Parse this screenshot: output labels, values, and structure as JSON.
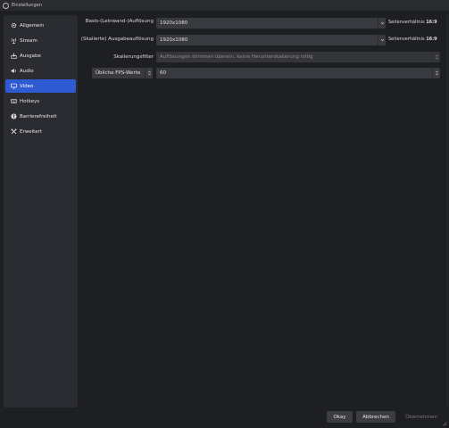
{
  "window": {
    "title": "Einstellungen"
  },
  "sidebar": {
    "items": [
      {
        "label": "Allgemein",
        "icon": "gear-icon"
      },
      {
        "label": "Stream",
        "icon": "antenna-icon"
      },
      {
        "label": "Ausgabe",
        "icon": "output-icon"
      },
      {
        "label": "Audio",
        "icon": "speaker-icon"
      },
      {
        "label": "Video",
        "icon": "monitor-icon",
        "active": true
      },
      {
        "label": "Hotkeys",
        "icon": "keyboard-icon"
      },
      {
        "label": "Barrierefreiheit",
        "icon": "accessibility-icon"
      },
      {
        "label": "Erweitert",
        "icon": "tools-icon"
      }
    ]
  },
  "video": {
    "base_resolution": {
      "label": "Basis-(Leinwand-)Auflösung",
      "value": "1920x1080",
      "aspect_prefix": "Seitenverhältnis",
      "aspect_value": "16:9"
    },
    "output_resolution": {
      "label": "(Skalierte) Ausgabeauflösung",
      "value": "1920x1080",
      "aspect_prefix": "Seitenverhältnis",
      "aspect_value": "16:9"
    },
    "scale_filter": {
      "label": "Skalierungsfilter",
      "value": "Auflösungen stimmen überein, keine Herunterskalierung nötig"
    },
    "fps": {
      "type_label": "Übliche FPS-Werte",
      "value": "60"
    }
  },
  "buttons": {
    "ok": "Okay",
    "cancel": "Abbrechen",
    "apply": "Übernehmen"
  },
  "colors": {
    "accent": "#2f5bd2",
    "background": "#1e1f22",
    "sidebar": "#2b2c31",
    "field": "#393a40"
  }
}
